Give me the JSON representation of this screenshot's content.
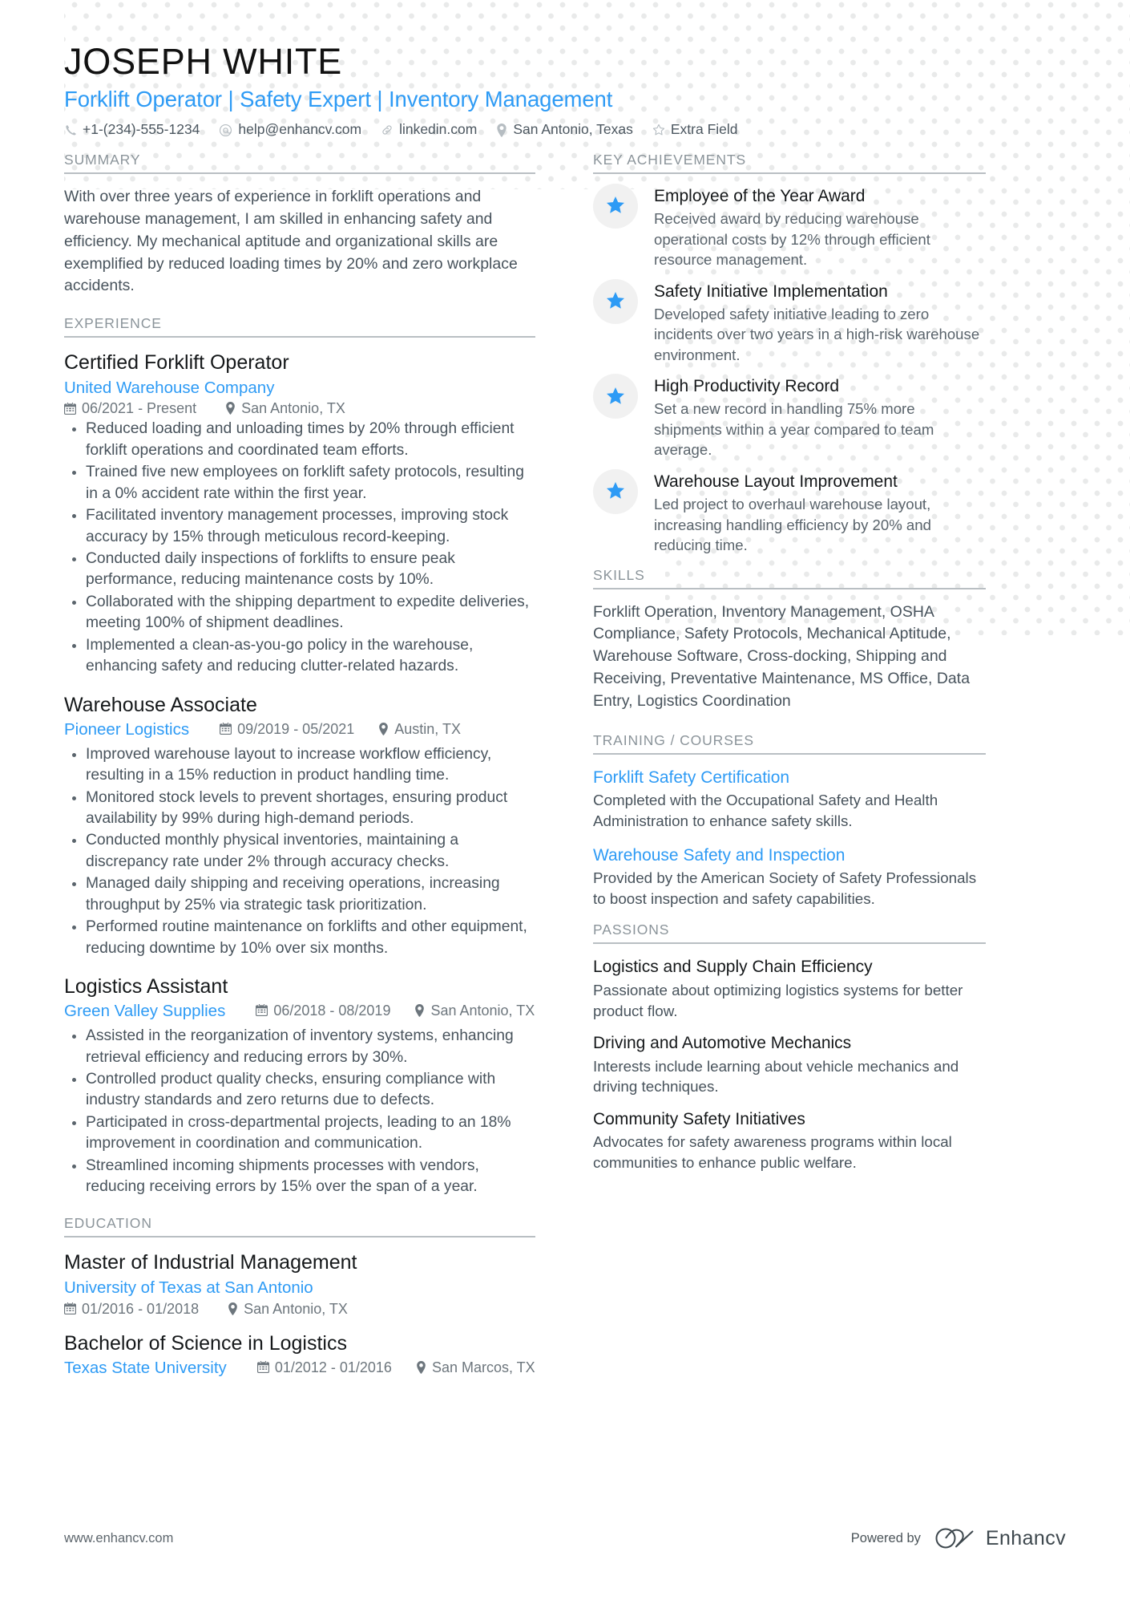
{
  "header": {
    "name": "JOSEPH WHITE",
    "job_title": "Forklift Operator | Safety Expert | Inventory Management",
    "contacts": [
      {
        "icon": "phone-icon",
        "text": "+1-(234)-555-1234"
      },
      {
        "icon": "email-icon",
        "text": "help@enhancv.com"
      },
      {
        "icon": "link-icon",
        "text": "linkedin.com"
      },
      {
        "icon": "location-pin-icon",
        "text": "San Antonio, Texas"
      },
      {
        "icon": "star-outline-icon",
        "text": "Extra Field"
      }
    ]
  },
  "left": {
    "summary": {
      "heading": "SUMMARY",
      "text": "With over three years of experience in forklift operations and warehouse management, I am skilled in enhancing safety and efficiency. My mechanical aptitude and organizational skills are exemplified by reduced loading times by 20% and zero workplace accidents."
    },
    "experience": {
      "heading": "EXPERIENCE",
      "entries": [
        {
          "title": "Certified Forklift Operator",
          "company": "United Warehouse Company",
          "date": "06/2021 - Present",
          "location": "San Antonio, TX",
          "inline_meta": false,
          "bullets": [
            "Reduced loading and unloading times by 20% through efficient forklift operations and coordinated team efforts.",
            "Trained five new employees on forklift safety protocols, resulting in a 0% accident rate within the first year.",
            "Facilitated inventory management processes, improving stock accuracy by 15% through meticulous record-keeping.",
            "Conducted daily inspections of forklifts to ensure peak performance, reducing maintenance costs by 10%.",
            "Collaborated with the shipping department to expedite deliveries, meeting 100% of shipment deadlines.",
            "Implemented a clean-as-you-go policy in the warehouse, enhancing safety and reducing clutter-related hazards."
          ]
        },
        {
          "title": "Warehouse Associate",
          "company": "Pioneer Logistics",
          "date": "09/2019 - 05/2021",
          "location": "Austin, TX",
          "inline_meta": true,
          "bullets": [
            "Improved warehouse layout to increase workflow efficiency, resulting in a 15% reduction in product handling time.",
            "Monitored stock levels to prevent shortages, ensuring product availability by 99% during high-demand periods.",
            "Conducted monthly physical inventories, maintaining a discrepancy rate under 2% through accuracy checks.",
            "Managed daily shipping and receiving operations, increasing throughput by 25% via strategic task prioritization.",
            "Performed routine maintenance on forklifts and other equipment, reducing downtime by 10% over six months."
          ]
        },
        {
          "title": "Logistics Assistant",
          "company": "Green Valley Supplies",
          "date": "06/2018 - 08/2019",
          "location": "San Antonio, TX",
          "inline_meta": true,
          "bullets": [
            "Assisted in the reorganization of inventory systems, enhancing retrieval efficiency and reducing errors by 30%.",
            "Controlled product quality checks, ensuring compliance with industry standards and zero returns due to defects.",
            "Participated in cross-departmental projects, leading to an 18% improvement in coordination and communication.",
            "Streamlined incoming shipments processes with vendors, reducing receiving errors by 15% over the span of a year."
          ]
        }
      ]
    },
    "education": {
      "heading": "EDUCATION",
      "entries": [
        {
          "title": "Master of Industrial Management",
          "company": "University of Texas at San Antonio",
          "date": "01/2016 - 01/2018",
          "location": "San Antonio, TX",
          "inline_meta": false
        },
        {
          "title": "Bachelor of Science in Logistics",
          "company": "Texas State University",
          "date": "01/2012 - 01/2016",
          "location": "San Marcos, TX",
          "inline_meta": true
        }
      ]
    }
  },
  "right": {
    "key_achievements": {
      "heading": "KEY ACHIEVEMENTS",
      "items": [
        {
          "icon": "star-icon",
          "title": "Employee of the Year Award",
          "desc": "Received award by reducing warehouse operational costs by 12% through efficient resource management."
        },
        {
          "icon": "star-icon",
          "title": "Safety Initiative Implementation",
          "desc": "Developed safety initiative leading to zero incidents over two years in a high-risk warehouse environment."
        },
        {
          "icon": "star-icon",
          "title": "High Productivity Record",
          "desc": "Set a new record in handling 75% more shipments within a year compared to team average."
        },
        {
          "icon": "star-icon",
          "title": "Warehouse Layout Improvement",
          "desc": "Led project to overhaul warehouse layout, increasing handling efficiency by 20% and reducing time."
        }
      ]
    },
    "skills": {
      "heading": "SKILLS",
      "text": "Forklift Operation, Inventory Management, OSHA Compliance, Safety Protocols, Mechanical Aptitude, Warehouse Software, Cross-docking, Shipping and Receiving, Preventative Maintenance, MS Office, Data Entry, Logistics Coordination"
    },
    "training": {
      "heading": "TRAINING / COURSES",
      "items": [
        {
          "title": "Forklift Safety Certification",
          "desc": "Completed with the Occupational Safety and Health Administration to enhance safety skills."
        },
        {
          "title": "Warehouse Safety and Inspection",
          "desc": "Provided by the American Society of Safety Professionals to boost inspection and safety capabilities."
        }
      ]
    },
    "passions": {
      "heading": "PASSIONS",
      "items": [
        {
          "title": "Logistics and Supply Chain Efficiency",
          "desc": "Passionate about optimizing logistics systems for better product flow."
        },
        {
          "title": "Driving and Automotive Mechanics",
          "desc": "Interests include learning about vehicle mechanics and driving techniques."
        },
        {
          "title": "Community Safety Initiatives",
          "desc": "Advocates for safety awareness programs within local communities to enhance public welfare."
        }
      ]
    }
  },
  "footer": {
    "url": "www.enhancv.com",
    "powered_by": "Powered by",
    "brand": "Enhancv"
  },
  "colors": {
    "accent": "#2e9bf5",
    "text": "#48535c",
    "heading": "#8b949a",
    "rule": "#b9bfc3",
    "badge_bg": "#f1f1f1",
    "dot": "#e9eaea"
  }
}
